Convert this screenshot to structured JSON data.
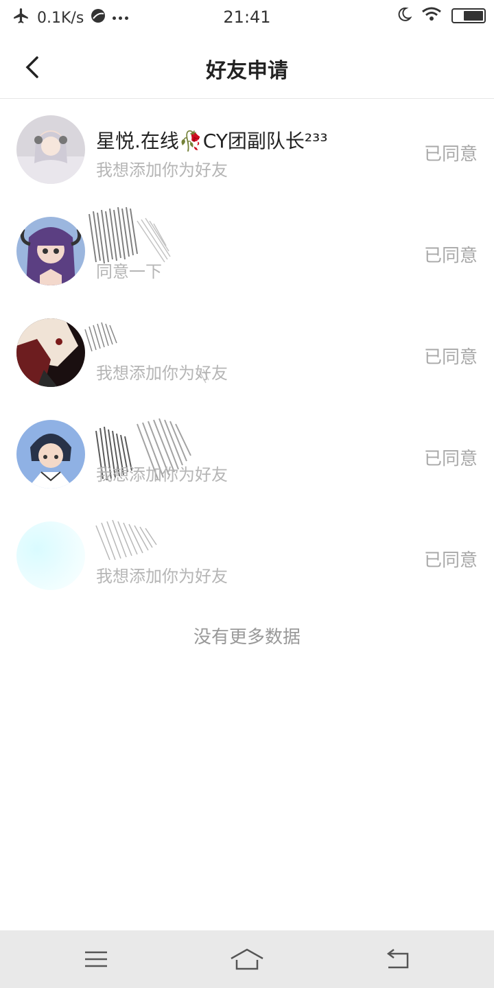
{
  "status_bar": {
    "net_speed": "0.1K/s",
    "time": "21:41"
  },
  "header": {
    "title": "好友申请"
  },
  "requests": [
    {
      "name": "星悦.在线🥀CY团副队长²³³",
      "message": "我想添加你为好友",
      "status": "已同意"
    },
    {
      "name": "",
      "message": "同意一下",
      "status": "已同意"
    },
    {
      "name": "",
      "message": "我想添加你为好友",
      "status": "已同意"
    },
    {
      "name": "",
      "message": "我想添加你为好友",
      "status": "已同意"
    },
    {
      "name": "",
      "message": "我想添加你为好友",
      "status": "已同意"
    }
  ],
  "footer": {
    "no_more": "没有更多数据"
  },
  "colors": {
    "text_primary": "#222222",
    "text_secondary": "#b5b5b5",
    "status_text": "#a8a8a8",
    "nav_bg": "#e9e9e9"
  },
  "icons": {
    "status": [
      "airplane-icon",
      "browser-icon",
      "more-dots-icon",
      "moon-icon",
      "wifi-icon",
      "battery-icon"
    ],
    "header": [
      "back-arrow-icon"
    ],
    "nav": [
      "menu-icon",
      "home-icon",
      "back-icon"
    ]
  }
}
